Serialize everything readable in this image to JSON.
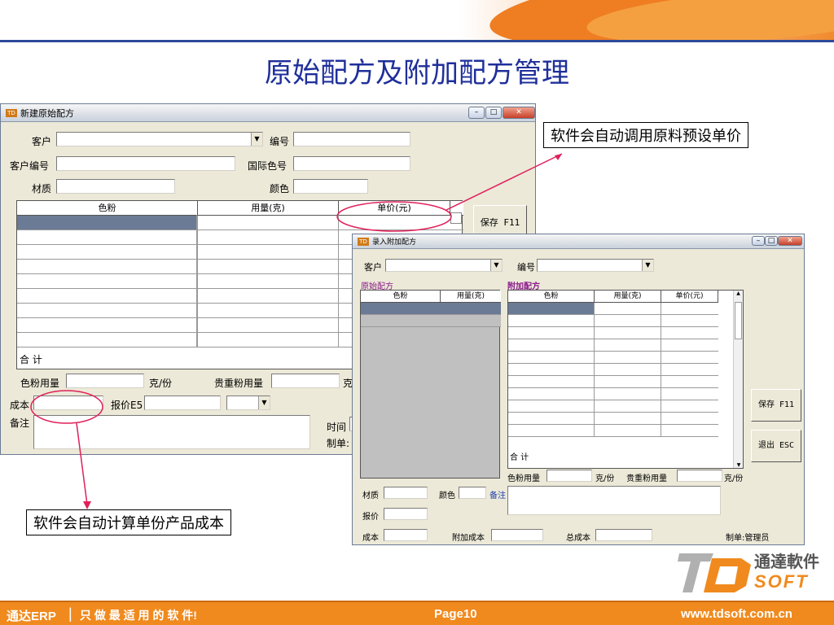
{
  "slide": {
    "title": "原始配方及附加配方管理"
  },
  "win1": {
    "title": "新建原始配方",
    "customer_label": "客户",
    "number_label": "编号",
    "customer_no_label": "客户编号",
    "intl_color_label": "国际色号",
    "material_label": "材质",
    "color_label": "颜色",
    "grid_headers": [
      "色粉",
      "用量(克)",
      "单价(元)"
    ],
    "total_label": "合 计",
    "powder_usage_label": "色粉用量",
    "unit1": "克/份",
    "precious_usage_label": "贵重粉用量",
    "unit2": "克",
    "cost_label": "成本",
    "quote_label": "报价E5",
    "remark_label": "备注",
    "time_label": "时间",
    "maker_label": "制单:",
    "save_button": "保存 F11"
  },
  "win2": {
    "title": "录入附加配方",
    "customer_label": "客户",
    "number_label": "编号",
    "original_label": "原始配方",
    "additional_label": "附加配方",
    "left_headers": [
      "色粉",
      "用量(克)"
    ],
    "right_headers": [
      "色粉",
      "用量(克)",
      "单价(元)"
    ],
    "total_label": "合 计",
    "powder_usage_label": "色粉用量",
    "unit1": "克/份",
    "precious_usage_label": "贵重粉用量",
    "unit2": "克/份",
    "material_label": "材质",
    "color_label": "颜色",
    "remark_label": "备注",
    "quote_label": "报价",
    "cost_label": "成本",
    "extra_cost_label": "附加成本",
    "total_cost_label": "总成本",
    "maker_label": "制单:管理员",
    "save_button": "保存 F11",
    "exit_button": "退出 ESC"
  },
  "callouts": {
    "top": "软件会自动调用原料预设单价",
    "bottom": "软件会自动计算单份产品成本"
  },
  "footer": {
    "brand": "通达ERP",
    "slogan": "只 做 最 适 用 的 软 件!",
    "page": "Page10",
    "url": "www.tdsoft.com.cn"
  },
  "logo": {
    "cn": "通達軟件",
    "en": "SOFT"
  },
  "colors": {
    "title": "#1f2f9a",
    "accent": "#f08a1e",
    "callout_line": "#e0205a"
  }
}
